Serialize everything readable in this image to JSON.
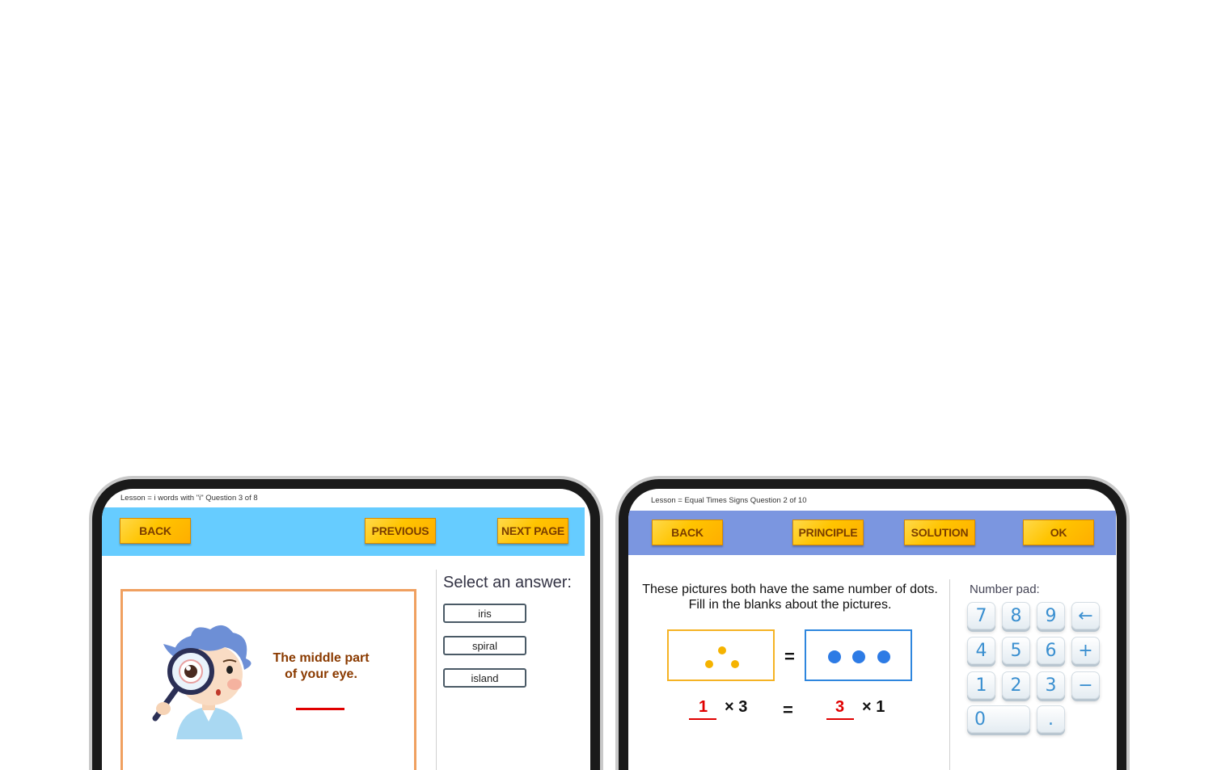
{
  "left": {
    "lesson_line": "Lesson = i words with \"i\" Question 3 of 8",
    "buttons": {
      "back": "BACK",
      "previous": "PREVIOUS",
      "next": "NEXT PAGE"
    },
    "question": {
      "clue_line1": "The middle part",
      "clue_line2": "of your eye."
    },
    "answers": {
      "title": "Select an answer:",
      "options": [
        "iris",
        "spiral",
        "island"
      ]
    }
  },
  "right": {
    "lesson_line": "Lesson = Equal Times Signs Question 2 of 10",
    "buttons": {
      "back": "BACK",
      "principle": "PRINCIPLE",
      "solution": "SOLUTION",
      "ok": "OK"
    },
    "instructions": {
      "line1": "These pictures both have the same number of dots.",
      "line2": "Fill in the blanks about the pictures."
    },
    "equation": {
      "answer_a": "1",
      "times_a": "× 3",
      "equals": "=",
      "answer_b": "3",
      "times_b": "× 1"
    },
    "number_pad": {
      "title": "Number pad:",
      "keys": [
        "7",
        "8",
        "9",
        "←",
        "4",
        "5",
        "6",
        "+",
        "1",
        "2",
        "3",
        "−",
        "0",
        "."
      ]
    }
  },
  "colors": {
    "left_toolbar": "#66ccff",
    "right_toolbar": "#7b96e0",
    "button": "#ffc400",
    "answer_red": "#e00000"
  }
}
